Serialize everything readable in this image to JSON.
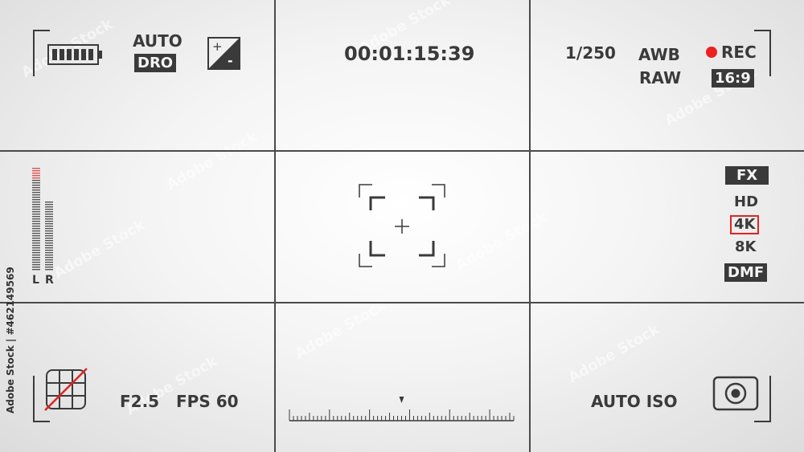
{
  "top_left": {
    "auto_label": "AUTO",
    "dro_label": "DRO"
  },
  "top_center": {
    "timecode": "00:01:15:39"
  },
  "top_right": {
    "shutter": "1/250",
    "awb": "AWB",
    "raw": "RAW",
    "rec": "REC",
    "aspect": "16:9",
    "rec_color": "#ef2020"
  },
  "audio": {
    "left_label": "L",
    "right_label": "R",
    "left_level": 0.95,
    "right_level": 0.65
  },
  "right_menu": {
    "fx": "FX",
    "hd": "HD",
    "fourk": "4K",
    "eightk": "8K",
    "dmf": "DMF",
    "highlight_color": "#e02424"
  },
  "bottom_left": {
    "aperture": "F2.5",
    "fps": "FPS 60"
  },
  "bottom_right": {
    "iso": "AUTO ISO"
  },
  "stock_credit": "Adobe Stock | #462149569",
  "watermark_text": "Adobe Stock"
}
